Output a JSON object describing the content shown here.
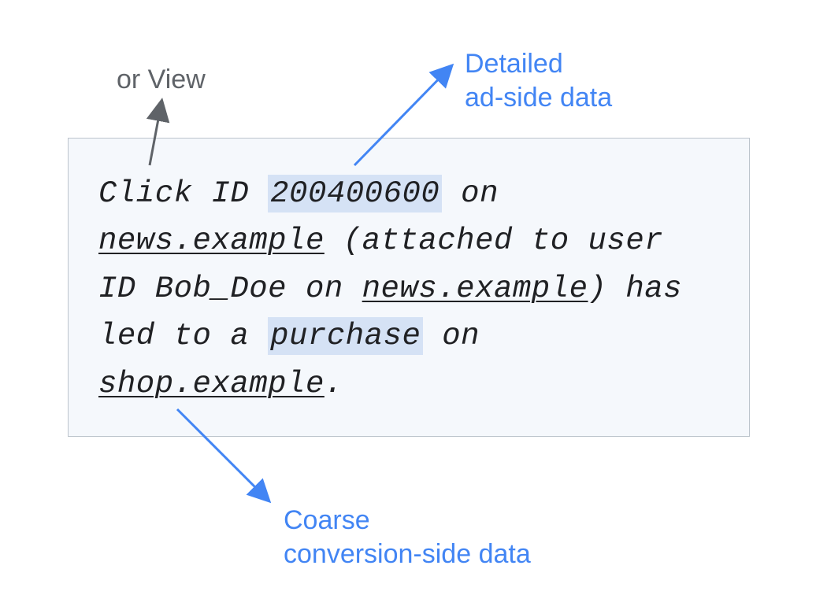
{
  "annotations": {
    "orView": "or View",
    "detailedLine1": "Detailed",
    "detailedLine2": "ad-side data",
    "coarseLine1": "Coarse",
    "coarseLine2": "conversion-side data"
  },
  "mainText": {
    "part1": "Click ID ",
    "clickId": "200400600",
    "part2": " on ",
    "site1": "news.example",
    "part3": " (attached to user ID Bob_Doe on ",
    "site2": "news.example",
    "part4": ") has led to a ",
    "eventType": "purchase",
    "part5": " on ",
    "site3": "shop.example",
    "part6": "."
  }
}
